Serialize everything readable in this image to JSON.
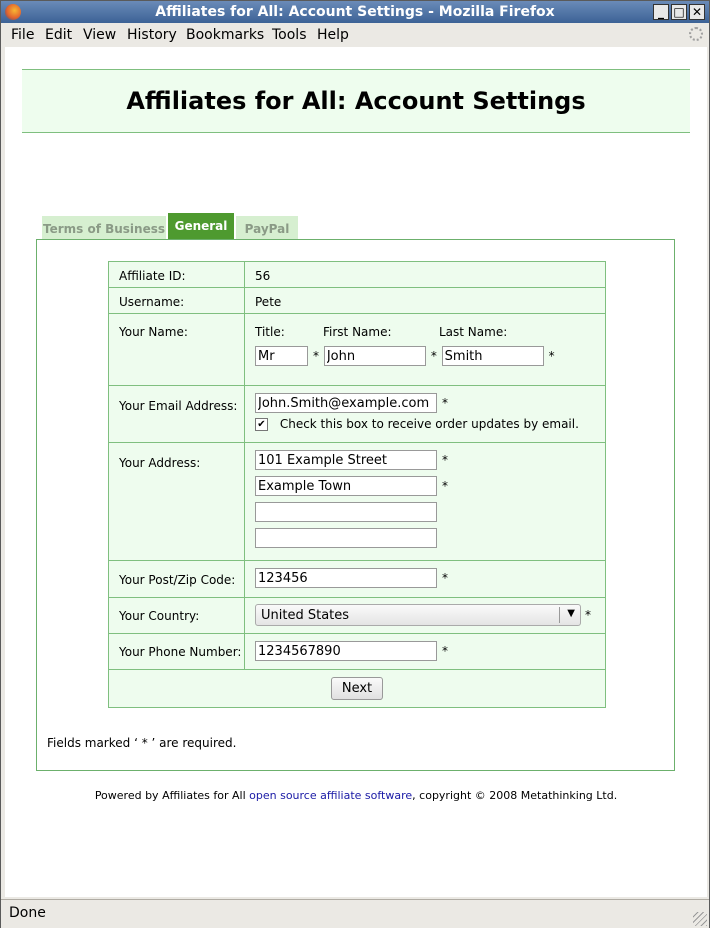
{
  "window": {
    "title": "Affiliates for All: Account Settings - Mozilla Firefox"
  },
  "menu": [
    "File",
    "Edit",
    "View",
    "History",
    "Bookmarks",
    "Tools",
    "Help"
  ],
  "page": {
    "heading": "Affiliates for All: Account Settings",
    "tabs": {
      "terms": "Terms of Business",
      "general": "General",
      "paypal": "PayPal"
    },
    "form": {
      "affiliate_id_label": "Affiliate ID:",
      "affiliate_id": "56",
      "username_label": "Username:",
      "username": "Pete",
      "name_label": "Your Name:",
      "title_label": "Title:",
      "first_name_label": "First Name:",
      "last_name_label": "Last Name:",
      "title": "Mr",
      "first_name": "John",
      "last_name": "Smith",
      "email_label": "Your Email Address:",
      "email": "John.Smith@example.com",
      "email_updates_label": "Check this box to receive order updates by email.",
      "email_updates_checked": true,
      "address_label": "Your Address:",
      "address1": "101 Example Street",
      "address2": "Example Town",
      "address3": "",
      "address4": "",
      "postcode_label": "Your Post/Zip Code:",
      "postcode": "123456",
      "country_label": "Your Country:",
      "country": "United States",
      "phone_label": "Your Phone Number:",
      "phone": "1234567890",
      "required_mark": "*",
      "next_button": "Next"
    },
    "required_note": "Fields marked ‘ * ’ are required.",
    "footer": {
      "prefix": "Powered by Affiliates for All ",
      "link": "open source affiliate software",
      "suffix": ", copyright © 2008 Metathinking Ltd."
    }
  },
  "status": "Done"
}
